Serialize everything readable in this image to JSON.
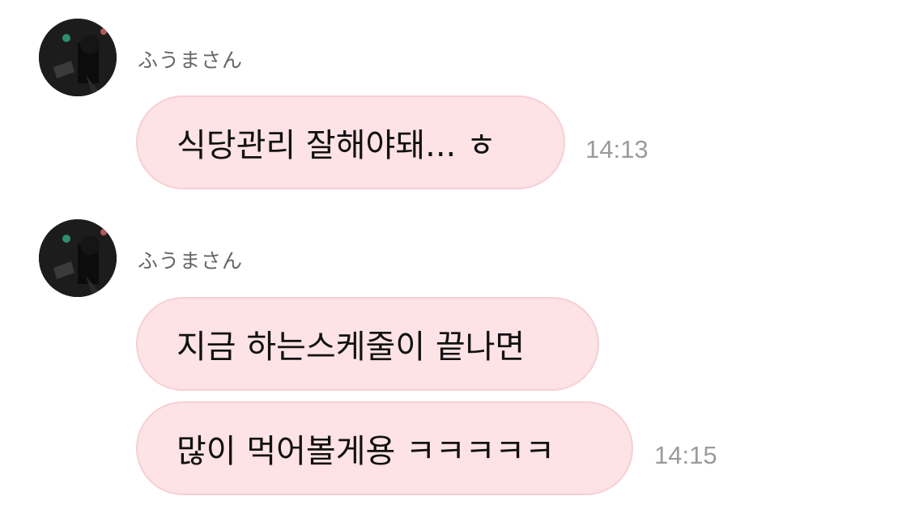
{
  "messages": [
    {
      "sender": "ふうまさん",
      "bubbles": [
        {
          "text": "식당관리 잘해야돼... ㅎ"
        }
      ],
      "time": "14:13"
    },
    {
      "sender": "ふうまさん",
      "bubbles": [
        {
          "text": "지금 하는스케줄이 끝나면"
        },
        {
          "text": "많이 먹어볼게용 ㅋㅋㅋㅋㅋ"
        }
      ],
      "time": "14:15"
    }
  ],
  "colors": {
    "bubble_background": "#fde2e6",
    "bubble_border": "#f7cfd5",
    "sender_name": "#666666",
    "timestamp": "#9b9b9b",
    "message_text": "#111111"
  }
}
